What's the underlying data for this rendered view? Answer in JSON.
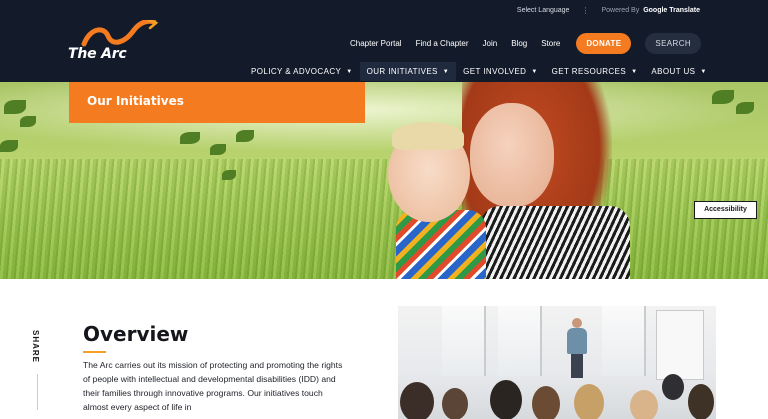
{
  "header": {
    "top": {
      "select_language": "Select Language",
      "separator": "⋮",
      "powered_by": "Powered By",
      "google_translate": "Google Translate"
    },
    "logo_text": "The Arc",
    "utility_nav": [
      "Chapter Portal",
      "Find a Chapter",
      "Join",
      "Blog",
      "Store"
    ],
    "donate_label": "DONATE",
    "search_label": "SEARCH",
    "main_nav": [
      {
        "label": "POLICY & ADVOCACY"
      },
      {
        "label": "OUR INITIATIVES"
      },
      {
        "label": "GET INVOLVED"
      },
      {
        "label": "GET RESOURCES"
      },
      {
        "label": "ABOUT US"
      }
    ],
    "caret": "▼"
  },
  "hero": {
    "badge_title": "Our Initiatives",
    "accessibility_label": "Accessibility"
  },
  "content": {
    "share_label": "SHARE",
    "overview_title": "Overview",
    "overview_body": "The Arc carries out its mission of protecting and promoting the rights of people with intellectual and developmental disabilities (IDD) and their families through innovative programs. Our initiatives touch almost every aspect of life in"
  },
  "colors": {
    "header_bg": "#131b2b",
    "accent_orange": "#f47b20",
    "accent_underline": "#f4a021"
  }
}
